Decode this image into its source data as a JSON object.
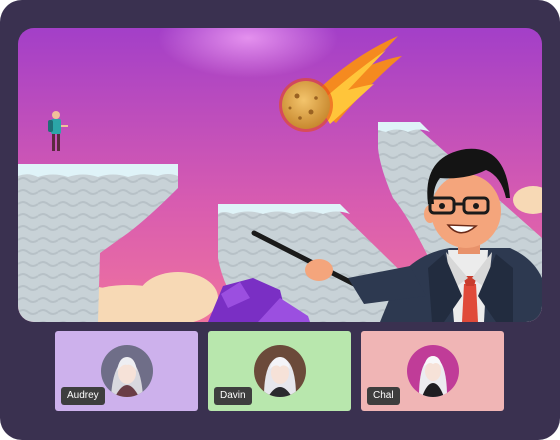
{
  "stage": {
    "scene": "platform-game-with-presenter",
    "colors": {
      "sky_top": "#a33fc8",
      "sky_bottom": "#f0739e",
      "ice_top": "#dff3f8",
      "rock": "#c9d3d8",
      "cloud": "#f7d9b5",
      "crystal": "#7a2fc4"
    }
  },
  "participants": [
    {
      "name": "Audrey",
      "tile_color": "#cdb1ec",
      "avatar_bg": "#6f6e88"
    },
    {
      "name": "Davin",
      "tile_color": "#b8e7ad",
      "avatar_bg": "#6b4a3a"
    },
    {
      "name": "Chal",
      "tile_color": "#f0b5b5",
      "avatar_bg": "#c03c98"
    }
  ]
}
